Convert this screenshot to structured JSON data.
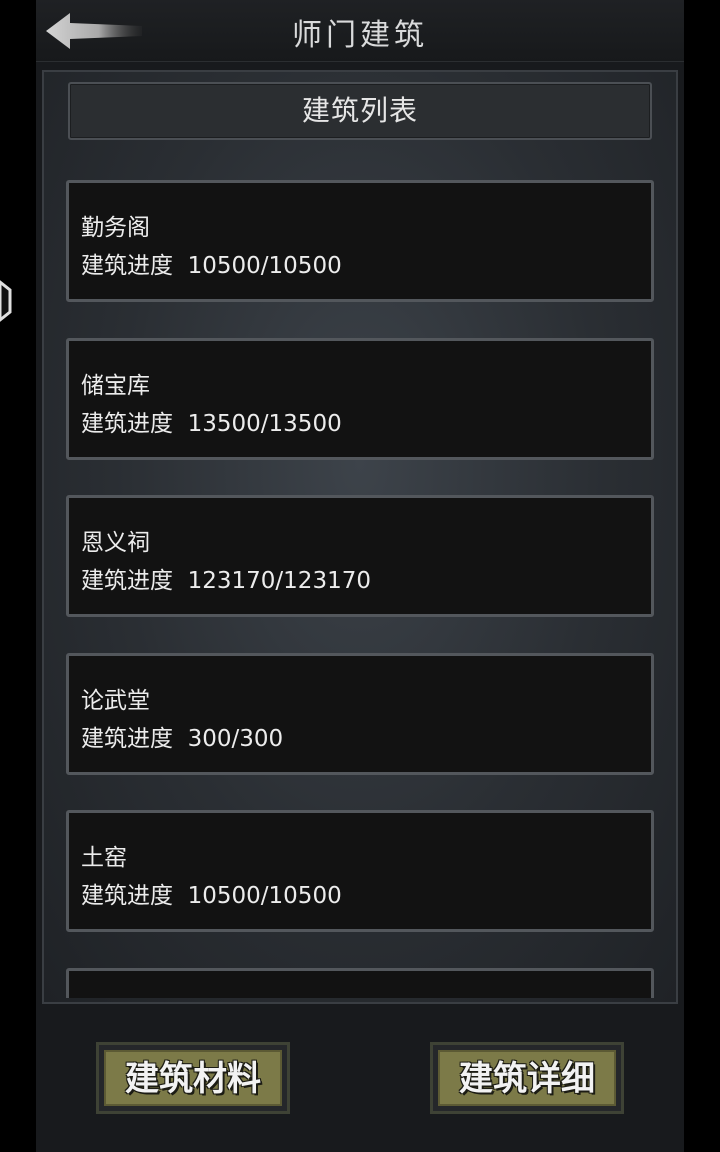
{
  "header": {
    "title": "师门建筑",
    "back_icon": "back-arrow-icon"
  },
  "list": {
    "title": "建筑列表",
    "progress_label": "建筑进度",
    "items": [
      {
        "name": "勤务阁",
        "progress": "10500/10500"
      },
      {
        "name": "储宝库",
        "progress": "13500/13500"
      },
      {
        "name": "恩义祠",
        "progress": "123170/123170"
      },
      {
        "name": "论武堂",
        "progress": "300/300"
      },
      {
        "name": "土窑",
        "progress": "10500/10500"
      },
      {
        "name": "",
        "progress": ""
      }
    ]
  },
  "footer": {
    "materials_label": "建筑材料",
    "details_label": "建筑详细"
  },
  "colors": {
    "button_fill": "#7c7a48",
    "card_bg": "#121212",
    "card_border": "#53575c"
  }
}
